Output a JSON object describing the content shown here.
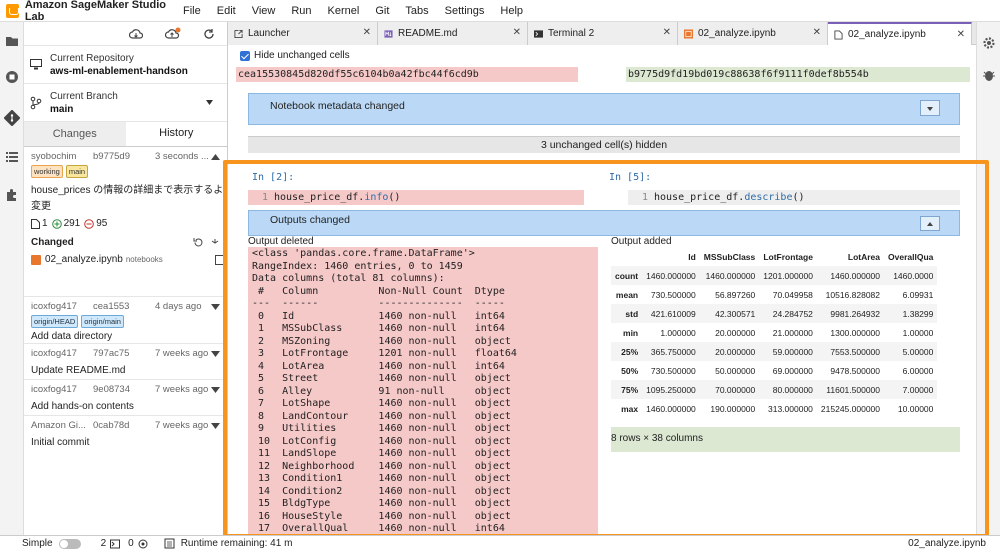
{
  "app": {
    "title": "Amazon SageMaker Studio Lab",
    "menu": [
      "File",
      "Edit",
      "View",
      "Run",
      "Kernel",
      "Git",
      "Tabs",
      "Settings",
      "Help"
    ]
  },
  "git_panel": {
    "current_repo_label": "Current Repository",
    "current_repo": "aws-ml-enablement-handson",
    "current_branch_label": "Current Branch",
    "current_branch": "main",
    "tabs": [
      "Changes",
      "History"
    ],
    "first_commit": {
      "author": "syobochim",
      "hash": "b9775d9",
      "date": "3 seconds ...",
      "tags": [
        "working",
        "main"
      ],
      "message_line1": "house_prices の情報の詳細まで表示するよう",
      "message_line2": "変更",
      "stats_files": "1",
      "stats_add": "291",
      "stats_del": "95",
      "changed_label": "Changed",
      "changed_file": "02_analyze.ipynb",
      "changed_dir": "notebooks"
    },
    "commits": [
      {
        "author": "icoxfog417",
        "hash": "cea1553",
        "date": "4 days ago",
        "tags": [
          "origin/HEAD",
          "origin/main"
        ],
        "message": "Add data directory"
      },
      {
        "author": "icoxfog417",
        "hash": "797ac75",
        "date": "7 weeks ago",
        "tags": [],
        "message": "Update README.md"
      },
      {
        "author": "icoxfog417",
        "hash": "9e08734",
        "date": "7 weeks ago",
        "tags": [],
        "message": "Add hands-on contents"
      },
      {
        "author": "Amazon Gi...",
        "hash": "0cab78d",
        "date": "7 weeks ago",
        "tags": [],
        "message": "Initial commit"
      }
    ]
  },
  "doc_tabs": [
    {
      "label": "Launcher"
    },
    {
      "label": "README.md"
    },
    {
      "label": "Terminal 2"
    },
    {
      "label": "02_analyze.ipynb"
    },
    {
      "label": "02_analyze.ipynb"
    }
  ],
  "diff": {
    "hide_unchanged_label": "Hide unchanged cells",
    "hash_left": "cea15530845d820df55c6104b0a42fbc44f6cd9b",
    "hash_right": "b9775d9fd19bd019c88638f6f9111f0def8b554b",
    "metadata_changed": "Notebook metadata changed",
    "unchanged_hidden": "3 unchanged cell(s) hidden",
    "in_left": "In [2]:",
    "in_right": "In [5]:",
    "line_no": "1",
    "code_left_prefix": "house_price_df.",
    "code_left_method": "info",
    "code_left_suffix": "()",
    "code_right_prefix": "house_price_df.",
    "code_right_method": "describe",
    "code_right_suffix": "()",
    "outputs_changed": "Outputs changed",
    "output_deleted_label": "Output deleted",
    "output_added_label": "Output added",
    "output_deleted_text": "<class 'pandas.core.frame.DataFrame'>\nRangeIndex: 1460 entries, 0 to 1459\nData columns (total 81 columns):\n #   Column          Non-Null Count  Dtype  \n---  ------          --------------  -----  \n 0   Id              1460 non-null   int64  \n 1   MSSubClass      1460 non-null   int64  \n 2   MSZoning        1460 non-null   object \n 3   LotFrontage     1201 non-null   float64\n 4   LotArea         1460 non-null   int64  \n 5   Street          1460 non-null   object \n 6   Alley           91 non-null     object \n 7   LotShape        1460 non-null   object \n 8   LandContour     1460 non-null   object \n 9   Utilities       1460 non-null   object \n 10  LotConfig       1460 non-null   object \n 11  LandSlope       1460 non-null   object \n 12  Neighborhood    1460 non-null   object \n 13  Condition1      1460 non-null   object \n 14  Condition2      1460 non-null   object \n 15  BldgType        1460 non-null   object \n 16  HouseStyle      1460 non-null   object \n 17  OverallQual     1460 non-null   int64  ",
    "describe_table": {
      "columns": [
        "",
        "Id",
        "MSSubClass",
        "LotFrontage",
        "LotArea",
        "OverallQua"
      ],
      "rows": [
        [
          "count",
          "1460.000000",
          "1460.000000",
          "1201.000000",
          "1460.000000",
          "1460.0000"
        ],
        [
          "mean",
          "730.500000",
          "56.897260",
          "70.049958",
          "10516.828082",
          "6.09931"
        ],
        [
          "std",
          "421.610009",
          "42.300571",
          "24.284752",
          "9981.264932",
          "1.38299"
        ],
        [
          "min",
          "1.000000",
          "20.000000",
          "21.000000",
          "1300.000000",
          "1.00000"
        ],
        [
          "25%",
          "365.750000",
          "20.000000",
          "59.000000",
          "7553.500000",
          "5.00000"
        ],
        [
          "50%",
          "730.500000",
          "50.000000",
          "69.000000",
          "9478.500000",
          "6.00000"
        ],
        [
          "75%",
          "1095.250000",
          "70.000000",
          "80.000000",
          "11601.500000",
          "7.00000"
        ],
        [
          "max",
          "1460.000000",
          "190.000000",
          "313.000000",
          "215245.000000",
          "10.00000"
        ]
      ],
      "shape": "8 rows × 38 columns"
    }
  },
  "status": {
    "mode": "Simple",
    "terminals": "2",
    "kernels": "0",
    "runtime": "Runtime remaining: 41 m",
    "active_file": "02_analyze.ipynb"
  },
  "colors": {
    "highlight": "#f7941d",
    "deleted_bg": "#f6c9c9",
    "added_bg": "#dce8d2",
    "section_bg": "#bbd9f6"
  }
}
